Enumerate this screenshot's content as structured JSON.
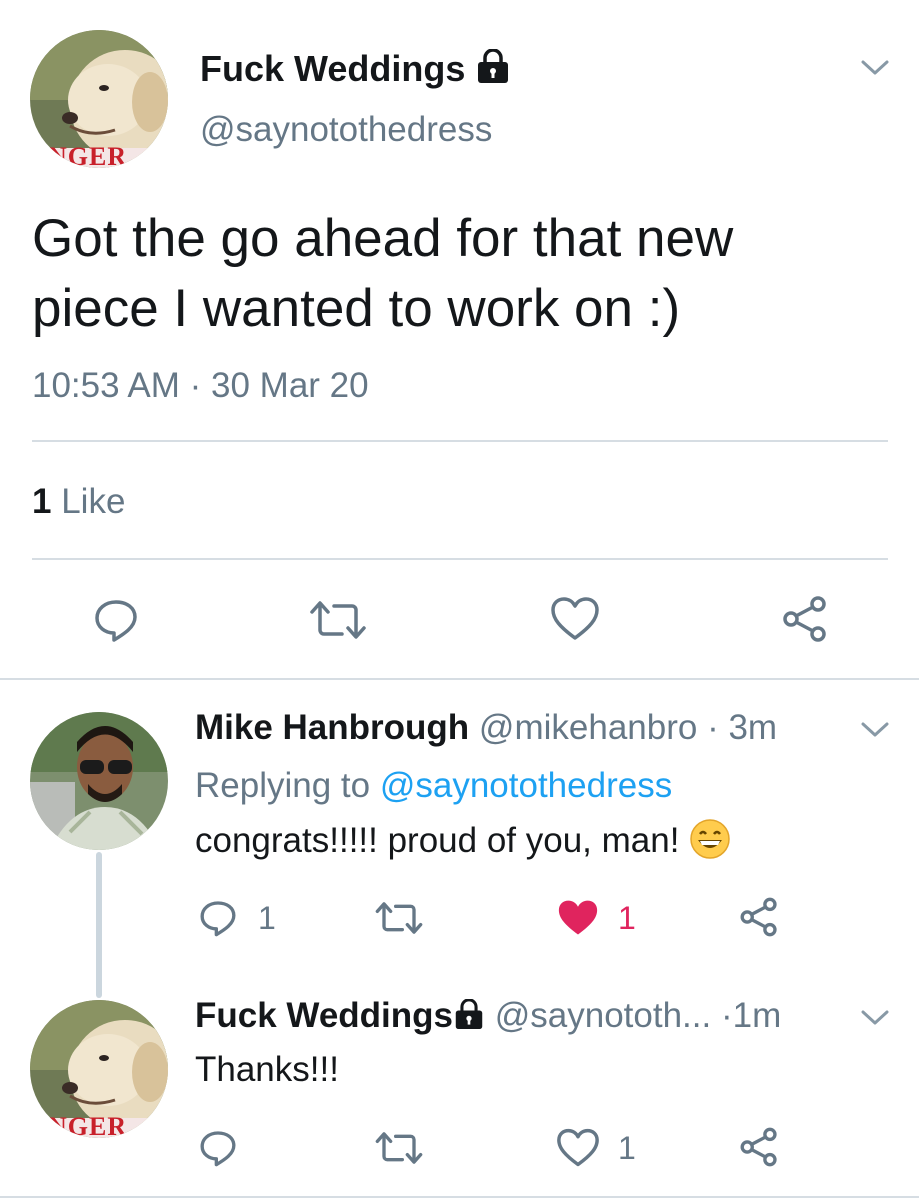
{
  "main_tweet": {
    "display_name": "Fuck Weddings",
    "handle": "@saynotothedress",
    "avatar_text": "NGER",
    "text_line1": "Got the go ahead for that new",
    "text_line2": "piece I wanted to work on :)",
    "time": "10:53 AM",
    "separator": "·",
    "date": "30 Mar 20",
    "likes_count": "1",
    "likes_label": "Like"
  },
  "reply1": {
    "display_name": "Mike Hanbrough",
    "handle": "@mikehanbro",
    "separator": "·",
    "time_ago": "3m",
    "replying_to_label": "Replying to",
    "replying_to_handle": "@saynotothedress",
    "text": "congrats!!!!! proud of you, man!",
    "reply_count": "1",
    "like_count": "1",
    "liked": true
  },
  "reply2": {
    "display_name": "Fuck Weddings",
    "handle": "@saynototh...",
    "separator": "·",
    "time_ago": "1m",
    "avatar_text": "NGER",
    "text": "Thanks!!!",
    "like_count": "1"
  },
  "colors": {
    "text": "#14171a",
    "secondary": "#657786",
    "link": "#1da1f2",
    "like_active": "#e0245e",
    "divider": "#d6dde3"
  },
  "icons": [
    "chevron-down-icon",
    "lock-icon",
    "reply-icon",
    "retweet-icon",
    "like-icon",
    "share-icon",
    "grinning-emoji-icon"
  ]
}
